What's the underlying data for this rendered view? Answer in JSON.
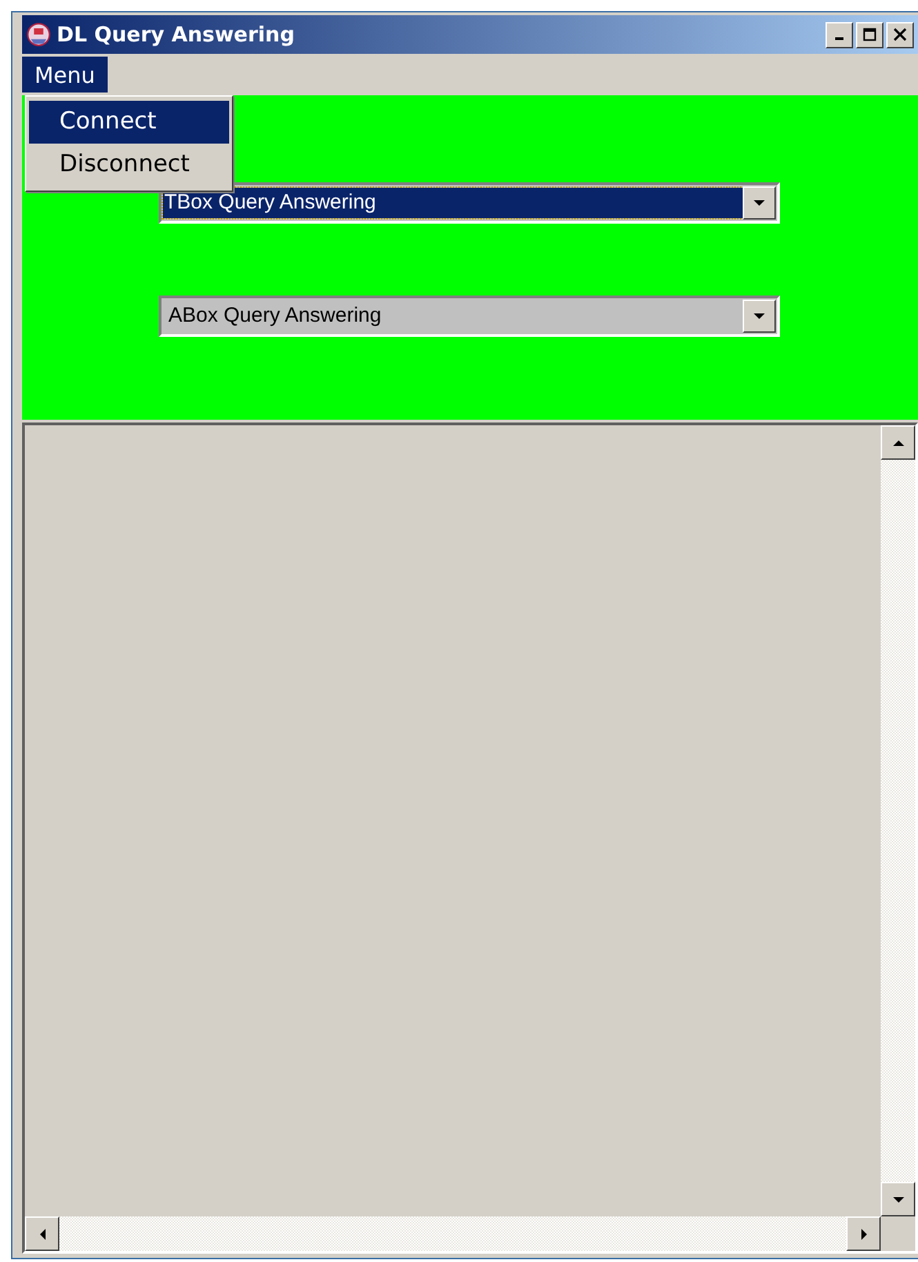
{
  "window": {
    "title": "DL Query Answering"
  },
  "menubar": {
    "menus": [
      {
        "label": "Menu",
        "open": true,
        "items": [
          {
            "label": "Connect",
            "selected": true
          },
          {
            "label": "Disconnect",
            "selected": false
          }
        ]
      }
    ]
  },
  "panel": {
    "combos": [
      {
        "value": "TBox Query Answering",
        "highlighted": true
      },
      {
        "value": "ABox Query Answering",
        "highlighted": false
      }
    ]
  }
}
